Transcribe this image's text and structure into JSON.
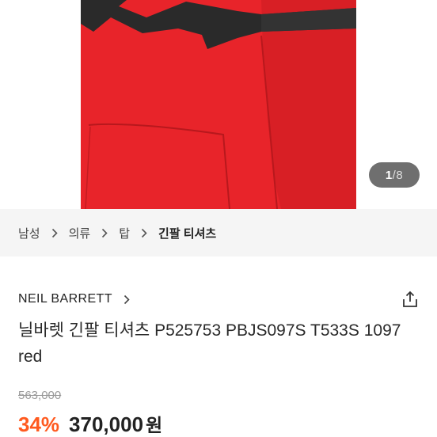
{
  "gallery": {
    "current_page": "1",
    "separator": "/",
    "total_pages": "8",
    "colors": {
      "garment_red": "#e8242a",
      "stripe_dark": "#2a2a2a"
    }
  },
  "breadcrumb": {
    "items": [
      "남성",
      "의류",
      "탑",
      "긴팔 티셔츠"
    ]
  },
  "product": {
    "brand": "NEIL BARRETT",
    "title": "닐바렛 긴팔 티셔츠 P525753 PBJS097S T533S 1097 red",
    "original_price": "563,000",
    "discount": "34%",
    "price": "370,000",
    "currency": "원"
  },
  "icons": {
    "breadcrumb_separator": "chevron-right-icon",
    "brand_link": "chevron-right-icon",
    "share": "share-icon"
  },
  "colors": {
    "discount": "#ff5a1f",
    "breadcrumb_bg": "#f5f5f5"
  }
}
